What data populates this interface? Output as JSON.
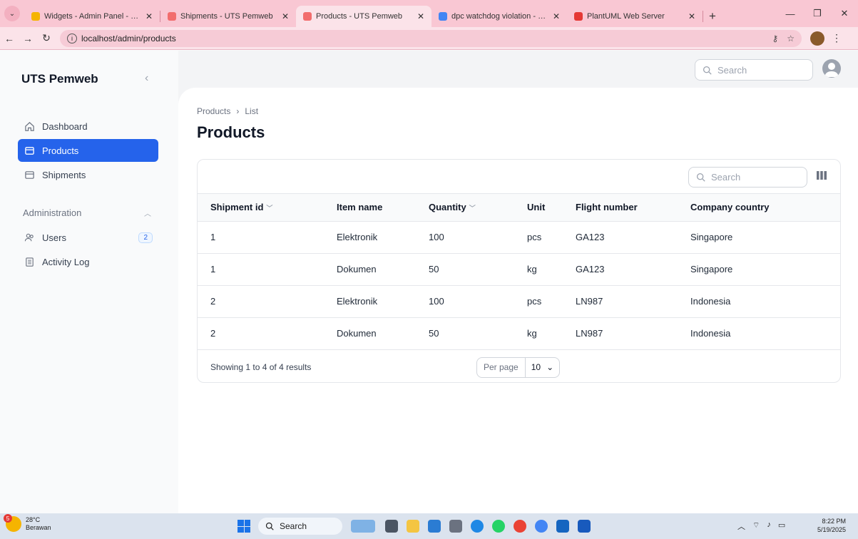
{
  "browser": {
    "tabs": [
      {
        "title": "Widgets - Admin Panel - Filame",
        "favicon_color": "#f5b400",
        "active": false
      },
      {
        "title": "Shipments - UTS Pemweb",
        "favicon_color": "#f26d6d",
        "active": false
      },
      {
        "title": "Products - UTS Pemweb",
        "favicon_color": "#f26d6d",
        "active": true
      },
      {
        "title": "dpc watchdog violation - Goog",
        "favicon_color": "#4285f4",
        "active": false
      },
      {
        "title": "PlantUML Web Server",
        "favicon_color": "#e53935",
        "active": false
      }
    ],
    "url": "localhost/admin/products"
  },
  "sidebar": {
    "brand": "UTS Pemweb",
    "items": [
      {
        "label": "Dashboard",
        "icon": "home-icon"
      },
      {
        "label": "Products",
        "icon": "box-icon",
        "active": true
      },
      {
        "label": "Shipments",
        "icon": "box-icon"
      }
    ],
    "group": {
      "label": "Administration",
      "items": [
        {
          "label": "Users",
          "icon": "users-icon",
          "badge": "2"
        },
        {
          "label": "Activity Log",
          "icon": "document-icon"
        }
      ]
    }
  },
  "topbar": {
    "search_placeholder": "Search"
  },
  "page": {
    "breadcrumb": [
      "Products",
      "List"
    ],
    "title": "Products"
  },
  "table": {
    "search_placeholder": "Search",
    "columns": [
      "Shipment id",
      "Item name",
      "Quantity",
      "Unit",
      "Flight number",
      "Company country"
    ],
    "rows": [
      [
        "1",
        "Elektronik",
        "100",
        "pcs",
        "GA123",
        "Singapore"
      ],
      [
        "1",
        "Dokumen",
        "50",
        "kg",
        "GA123",
        "Singapore"
      ],
      [
        "2",
        "Elektronik",
        "100",
        "pcs",
        "LN987",
        "Indonesia"
      ],
      [
        "2",
        "Dokumen",
        "50",
        "kg",
        "LN987",
        "Indonesia"
      ]
    ],
    "showing": "Showing 1 to 4 of 4 results",
    "per_page_label": "Per page",
    "per_page_value": "10"
  },
  "taskbar": {
    "weather_temp": "28°C",
    "weather_desc": "Berawan",
    "weather_badge": "5",
    "search_label": "Search",
    "time": "8:22 PM",
    "date": "5/19/2025"
  },
  "colors": {
    "accent": "#2563eb",
    "tabstrip": "#f9c7d3"
  }
}
